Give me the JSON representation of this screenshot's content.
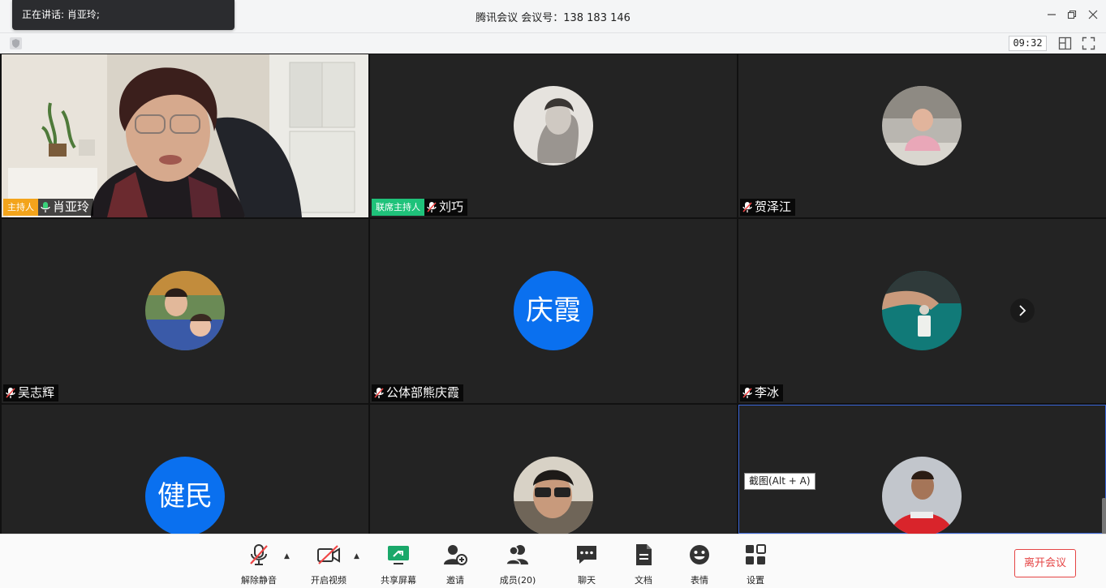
{
  "titlebar": {
    "speaking": "正在讲话: 肖亚玲;",
    "title": "腾讯会议 会议号：138 183 146"
  },
  "subbar": {
    "timer": "09:32"
  },
  "tiles": [
    {
      "name": "肖亚玲",
      "role": "主持人",
      "role_type": "host",
      "avatar_kind": "video",
      "mic": "on"
    },
    {
      "name": "刘巧",
      "role": "联席主持人",
      "role_type": "cohost",
      "avatar_kind": "photo",
      "mic": "muted"
    },
    {
      "name": "贺泽江",
      "avatar_kind": "photo",
      "mic": "muted"
    },
    {
      "name": "吴志辉",
      "avatar_kind": "photo",
      "mic": "muted"
    },
    {
      "name": "公体部熊庆霞",
      "avatar_kind": "letters",
      "avatar_text": "庆霞",
      "mic": "muted"
    },
    {
      "name": "李冰",
      "avatar_kind": "photo",
      "mic": "muted"
    },
    {
      "name": "",
      "avatar_kind": "letters",
      "avatar_text": "健民",
      "mic": "none"
    },
    {
      "name": "",
      "avatar_kind": "photo",
      "mic": "none"
    },
    {
      "name": "",
      "avatar_kind": "photo",
      "mic": "none"
    }
  ],
  "tooltip": "截图(Alt + A)",
  "toolbar": {
    "unmute": "解除静音",
    "video": "开启视频",
    "share": "共享屏幕",
    "invite": "邀请",
    "members": "成员(20)",
    "chat": "聊天",
    "docs": "文档",
    "emoji": "表情",
    "settings": "设置",
    "leave": "离开会议"
  },
  "colors": {
    "tile_bg": "#232323",
    "host": "#f3a41b",
    "cohost": "#1fc27a",
    "letter_avatar": "#0a70ef",
    "leave": "#e54545",
    "share_icon": "#1aa86a"
  }
}
